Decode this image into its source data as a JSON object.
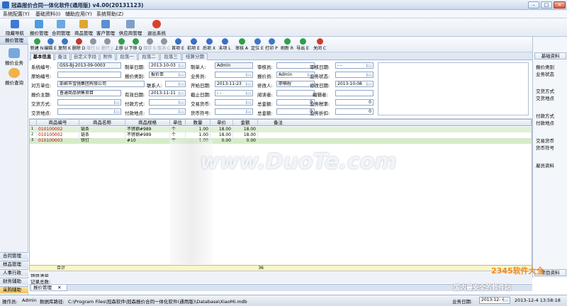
{
  "window": {
    "title": "冠森报价合同一体化软件(通用版) v4.00(20131123)",
    "min": "–",
    "max": "□",
    "close": "✕"
  },
  "menu": [
    "系统配置(Y)",
    "基础资料(I)",
    "辅助应用(Y)",
    "系统帮助(Z)"
  ],
  "main_toolbar": [
    "隐藏导航",
    "报价管理",
    "合同管理",
    "商品管理",
    "客户管理",
    "供应商管理",
    "退出系统"
  ],
  "left_nav": {
    "header": "报价管理",
    "items": [
      "报价业务",
      "报价查询"
    ],
    "bottom": [
      "合同管理",
      "样品管理",
      "人事行政",
      "财务辅助",
      "采购辅助"
    ]
  },
  "doc_toolbar": [
    {
      "label": "新建 N",
      "disabled": false
    },
    {
      "label": "编辑 E",
      "disabled": false
    },
    {
      "label": "复制 K",
      "disabled": false
    },
    {
      "label": "删除 D",
      "disabled": false
    },
    {
      "label": "增行 U",
      "disabled": true
    },
    {
      "label": "删行 J",
      "disabled": true
    },
    {
      "label": "上移 U",
      "disabled": false
    },
    {
      "label": "下移 Q",
      "disabled": false
    },
    {
      "label": "保存 S",
      "disabled": true
    },
    {
      "label": "取消 C",
      "disabled": true
    },
    {
      "label": "首项 E",
      "disabled": false
    },
    {
      "label": "前项 E",
      "disabled": false
    },
    {
      "label": "后项 X",
      "disabled": false
    },
    {
      "label": "末项 L",
      "disabled": false
    },
    {
      "label": "审核 A",
      "disabled": false
    },
    {
      "label": "定位 E",
      "disabled": false
    },
    {
      "label": "打印 P",
      "disabled": false
    },
    {
      "label": "刷新 R",
      "disabled": false
    },
    {
      "label": "导出 E",
      "disabled": false
    },
    {
      "label": "关闭 C",
      "disabled": false
    }
  ],
  "tabs": [
    "基本信息",
    "备注",
    "自定义字段",
    "附件",
    "段落一",
    "段落二",
    "段落三",
    "结算分期"
  ],
  "form": {
    "system_no_label": "系统编号:",
    "system_no": "GSS-BJ-2013-09-0003",
    "make_date_label": "制单日期:",
    "make_date": "2013-10-03",
    "maker_label": "制单人:",
    "maker": "Admin",
    "auditor_label": "审核员:",
    "auditor": "",
    "audit_date_label": "审核日期:",
    "audit_date": "- -",
    "orig_no_label": "原始编号:",
    "orig_no": "",
    "quote_type_label": "报价类别:",
    "quote_type": "报价单",
    "salesman_label": "业务员:",
    "salesman": "",
    "quoter_label": "报价员:",
    "quoter": "Admin",
    "biz_status_label": "业务状态:",
    "biz_status": "",
    "party_label": "对方单位:",
    "party": "邯郸市雪驰集团有限公司",
    "contact_label": "联系人:",
    "contact": "",
    "start_date_label": "开始日期:",
    "start_date": "2013-11-23",
    "modifier_label": "修改人:",
    "modifier": "廖楠程",
    "mod_date_label": "修改日期:",
    "mod_date": "2013-10-08",
    "subject_label": "报价主题:",
    "subject": "普通商品销售项目",
    "valid_date_label": "有效日期:",
    "valid_date": "2013-11-11",
    "end_date_label": "截止日期:",
    "end_date": "- -",
    "reader_label": "阅读者:",
    "reader": "",
    "editor_label": "编辑者:",
    "editor": "",
    "trade_mode_label": "交货方式:",
    "trade_mode": "",
    "pay_mode_label": "付款方式:",
    "pay_mode": "",
    "trade_currency_label": "交易货币:",
    "trade_currency": "",
    "total_qty_label": "总金额:",
    "total_qty": "0",
    "tax_rate_label": "业务税率:",
    "tax_rate": "0",
    "trade_place_label": "交货地点:",
    "trade_place": "",
    "pay_place_label": "付款地点:",
    "pay_place": "",
    "currency_sym_label": "货币符号:",
    "currency_sym": "",
    "total_amt_label": "总金额:",
    "total_amt": "0",
    "discount_label": "业务折扣:",
    "discount": "0"
  },
  "grid": {
    "headers": [
      "商品编号",
      "商品名称",
      "商品规格",
      "单位",
      "数量",
      "单价",
      "金额",
      "备注"
    ],
    "rows": [
      {
        "idx": "1",
        "marker": "▶",
        "code": "010100002",
        "name": "链条",
        "spec": "不锈钢#989",
        "unit": "个",
        "qty": "1.00",
        "price": "18.00",
        "amount": "18.00",
        "note": ""
      },
      {
        "idx": "2",
        "marker": "",
        "code": "010100002",
        "name": "链条",
        "spec": "不锈钢#989",
        "unit": "个",
        "qty": "1.00",
        "price": "18.00",
        "amount": "18.00",
        "note": ""
      },
      {
        "idx": "3",
        "marker": "",
        "code": "010100003",
        "name": "铁钉",
        "spec": "#10",
        "unit": "个",
        "qty": "1.00",
        "price": "0.00",
        "amount": "0.00",
        "note": ""
      }
    ],
    "total_label": "合计",
    "total_value": "36"
  },
  "right_panel": {
    "head": "基础资料",
    "items": [
      "报价类别",
      "业务状态",
      "交货方式",
      "交货地点",
      "付款方式",
      "付款地点",
      "交易货币",
      "货币符号",
      "雇员资料"
    ],
    "footer": "项目资料"
  },
  "footer": {
    "project_list": "项目清单",
    "record_count": "记录总数:",
    "doc_tab": "报价管理",
    "doc_tab_close": "✕"
  },
  "status": {
    "operator_label": "操作员:",
    "operator": "Admin",
    "db_label": "数据库路径:",
    "db": "C:\\Program Files\\冠森软件\\冠森报价合同一体化软件(通用版)\\Database\\XiaoMi.mdb",
    "biz_date_label": "业务日期:",
    "biz_date": "2013-12- 4",
    "datetime": "2013-12-4 13:58:18"
  },
  "watermarks": {
    "center": "www.DuoTe.com",
    "brand": "2345软件大全",
    "slogan": "国内最安全的软件站"
  }
}
